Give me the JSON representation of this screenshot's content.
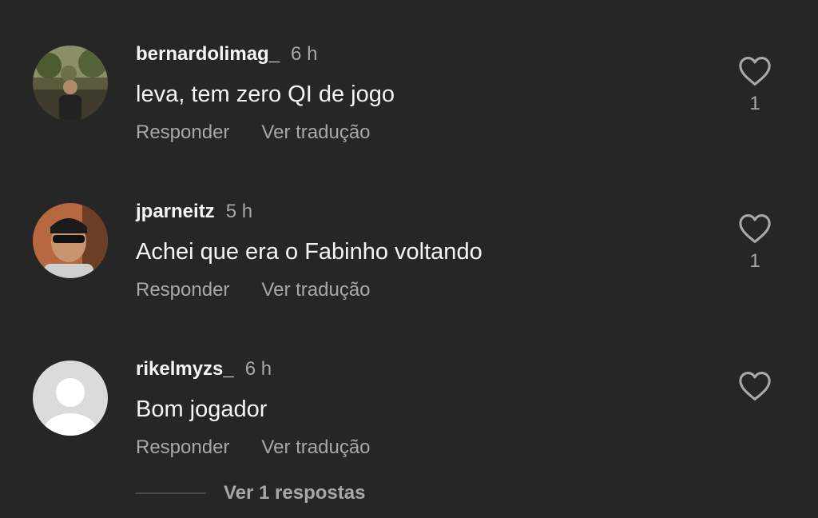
{
  "comments": [
    {
      "username": "bernardolimag_",
      "time": "6 h",
      "text": "leva, tem zero QI de jogo",
      "reply_label": "Responder",
      "translate_label": "Ver tradução",
      "likes": "1",
      "avatar": "photo-avatar"
    },
    {
      "username": "jparneitz",
      "time": "5 h",
      "text": "Achei que era o Fabinho voltando",
      "reply_label": "Responder",
      "translate_label": "Ver tradução",
      "likes": "1",
      "avatar": "photo-avatar"
    },
    {
      "username": "rikelmyzs_",
      "time": "6 h",
      "text": "Bom jogador",
      "reply_label": "Responder",
      "translate_label": "Ver tradução",
      "likes": "",
      "avatar": "default-avatar"
    }
  ],
  "replies_toggle": {
    "label": "Ver 1 respostas"
  },
  "colors": {
    "background": "#262626",
    "primary_text": "#f5f5f5",
    "secondary_text": "#a8a8a8"
  }
}
